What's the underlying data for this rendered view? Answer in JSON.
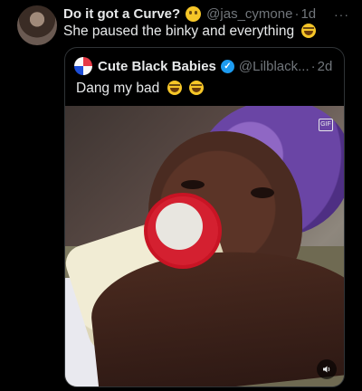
{
  "tweet": {
    "author_name": "Do it got a Curve?",
    "author_emoji": "winking-face-with-tongue-emoji",
    "handle": "@jas_cymone",
    "separator": "·",
    "time": "1d",
    "text": "She paused the binky and everything",
    "text_emoji": "laughing-tears-emoji",
    "more_label": "···"
  },
  "quote": {
    "author_name": "Cute Black Babies",
    "handle": "@Lilblack...",
    "separator": "·",
    "time": "2d",
    "text": "Dang my bad",
    "text_emojis": [
      "laughing-tears-emoji",
      "laughing-tears-emoji"
    ],
    "media": {
      "type": "gif",
      "badge": "GIF",
      "sound_icon": "speaker-icon"
    }
  }
}
